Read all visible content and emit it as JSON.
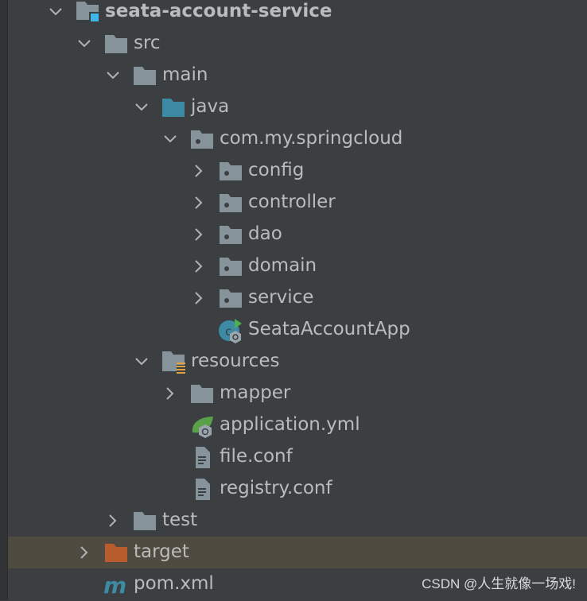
{
  "tree": [
    {
      "label": "seata-account-service",
      "level": 0,
      "chevron": "open",
      "icon": "module-folder-icon",
      "bold": true
    },
    {
      "label": "src",
      "level": 1,
      "chevron": "open",
      "icon": "folder-icon"
    },
    {
      "label": "main",
      "level": 2,
      "chevron": "open",
      "icon": "folder-icon"
    },
    {
      "label": "java",
      "level": 3,
      "chevron": "open",
      "icon": "source-folder-icon"
    },
    {
      "label": "com.my.springcloud",
      "level": 4,
      "chevron": "open",
      "icon": "package-icon"
    },
    {
      "label": "config",
      "level": 5,
      "chevron": "closed",
      "icon": "package-icon"
    },
    {
      "label": "controller",
      "level": 5,
      "chevron": "closed",
      "icon": "package-icon"
    },
    {
      "label": "dao",
      "level": 5,
      "chevron": "closed",
      "icon": "package-icon"
    },
    {
      "label": "domain",
      "level": 5,
      "chevron": "closed",
      "icon": "package-icon"
    },
    {
      "label": "service",
      "level": 5,
      "chevron": "closed",
      "icon": "package-icon"
    },
    {
      "label": "SeataAccountApp",
      "level": 5,
      "chevron": "none",
      "icon": "spring-boot-class-icon"
    },
    {
      "label": "resources",
      "level": 3,
      "chevron": "open",
      "icon": "resources-folder-icon"
    },
    {
      "label": "mapper",
      "level": 4,
      "chevron": "closed",
      "icon": "folder-icon"
    },
    {
      "label": "application.yml",
      "level": 4,
      "chevron": "none",
      "icon": "spring-config-icon"
    },
    {
      "label": "file.conf",
      "level": 4,
      "chevron": "none",
      "icon": "text-file-icon"
    },
    {
      "label": "registry.conf",
      "level": 4,
      "chevron": "none",
      "icon": "text-file-icon"
    },
    {
      "label": "test",
      "level": 2,
      "chevron": "closed",
      "icon": "folder-icon"
    },
    {
      "label": "target",
      "level": 1,
      "chevron": "closed",
      "icon": "excluded-folder-icon",
      "selected": true
    },
    {
      "label": "pom.xml",
      "level": 1,
      "chevron": "none",
      "icon": "maven-icon"
    }
  ],
  "colors": {
    "background": "#3c3f41",
    "selected_row": "#4f4b41",
    "folder": "#87939a",
    "source_folder": "#3d8aa5",
    "excluded_folder": "#b85c2e",
    "module_badge": "#3fb5e8",
    "resources_badge": "#e0a23c",
    "spring": "#5aa048",
    "text": "#bbbbbb"
  },
  "watermark": "CSDN @人生就像一场戏!"
}
